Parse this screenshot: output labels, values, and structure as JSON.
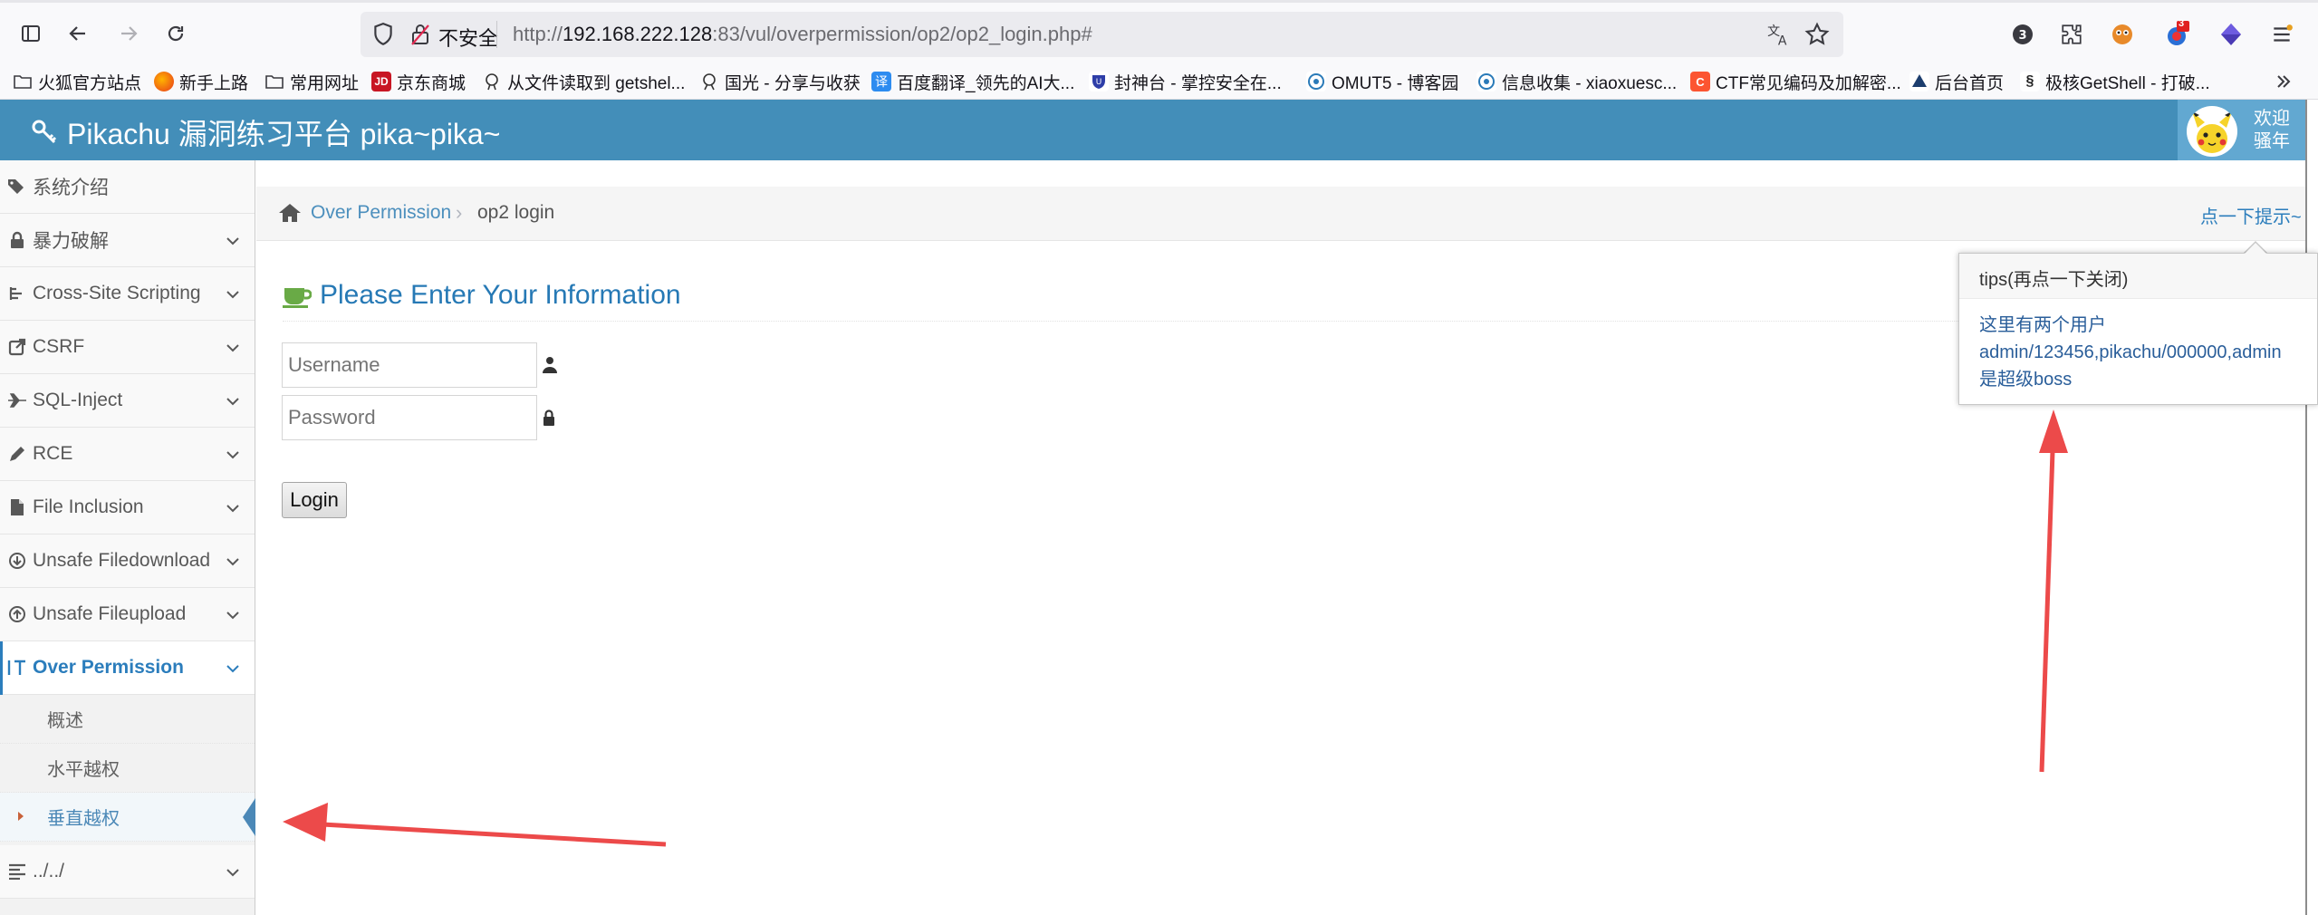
{
  "browser": {
    "url_security_label": "不安全",
    "url_prefix": "http://",
    "url_host": "192.168.222.128",
    "url_rest": ":83/vul/overpermission/op2/op2_login.php#",
    "notification_badge": "3",
    "bookmarks": [
      {
        "label": "火狐官方站点",
        "icon": "folder-icon"
      },
      {
        "label": "新手上路",
        "icon": "firefox-icon"
      },
      {
        "label": "常用网址",
        "icon": "folder-icon"
      },
      {
        "label": "京东商城",
        "icon": "jd-icon"
      },
      {
        "label": "从文件读取到 getshel...",
        "icon": "site-icon"
      },
      {
        "label": "国光 - 分享与收获",
        "icon": "site-icon"
      },
      {
        "label": "百度翻译_领先的AI大...",
        "icon": "translate-icon"
      },
      {
        "label": "封神台 - 掌控安全在...",
        "icon": "site-icon"
      },
      {
        "label": "OMUT5 - 博客园",
        "icon": "site-icon"
      },
      {
        "label": "信息收集 - xiaoxuesc...",
        "icon": "site-icon"
      },
      {
        "label": "CTF常见编码及加解密...",
        "icon": "csdn-icon"
      },
      {
        "label": "后台首页",
        "icon": "site-icon"
      },
      {
        "label": "极核GetShell - 打破...",
        "icon": "site-icon"
      }
    ]
  },
  "app": {
    "title": "Pikachu 漏洞练习平台 pika~pika~",
    "welcome_line1": "欢迎",
    "welcome_line2": "骚年",
    "accent": "#438eb9"
  },
  "sidebar": {
    "items": [
      {
        "label": "系统介绍",
        "icon": "tags-icon"
      },
      {
        "label": "暴力破解",
        "icon": "lock-icon"
      },
      {
        "label": "Cross-Site Scripting",
        "icon": "tree-icon"
      },
      {
        "label": "CSRF",
        "icon": "share-icon"
      },
      {
        "label": "SQL-Inject",
        "icon": "plane-icon"
      },
      {
        "label": "RCE",
        "icon": "pencil-icon"
      },
      {
        "label": "File Inclusion",
        "icon": "file-icon"
      },
      {
        "label": "Unsafe Filedownload",
        "icon": "download-icon"
      },
      {
        "label": "Unsafe Fileupload",
        "icon": "upload-icon"
      },
      {
        "label": "Over Permission",
        "icon": "text-height-icon"
      },
      {
        "label": "../../",
        "icon": "align-left-icon"
      }
    ],
    "submenu": [
      "概述",
      "水平越权",
      "垂直越权"
    ]
  },
  "breadcrumb": {
    "link": "Over Permission",
    "current": "op2 login"
  },
  "hint_link": "点一下提示~",
  "form": {
    "title": "Please Enter Your Information",
    "username_placeholder": "Username",
    "password_placeholder": "Password",
    "login_label": "Login"
  },
  "tips": {
    "title": "tips(再点一下关闭)",
    "line1": "这里有两个用户",
    "line2": "admin/123456,pikachu/000000,admin",
    "line3": "是超级boss"
  }
}
